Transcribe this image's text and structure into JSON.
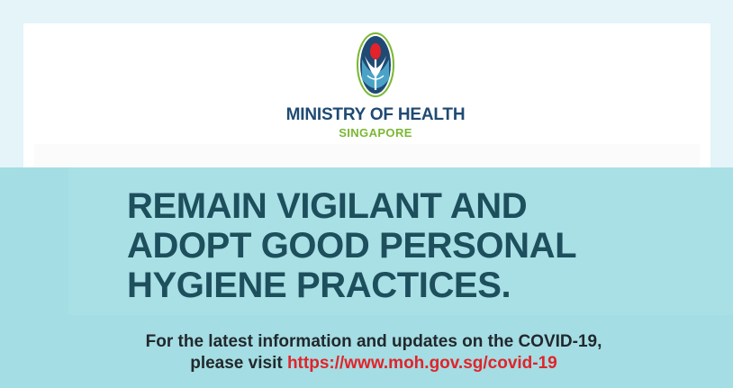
{
  "header": {
    "logo_icon": "moh-singapore-logo-icon",
    "ministry_name": "MINISTRY OF HEALTH",
    "country": "SINGAPORE"
  },
  "banner": {
    "headline_lines": [
      "REMAIN VIGILANT AND",
      "ADOPT GOOD PERSONAL",
      "HYGIENE PRACTICES."
    ],
    "info_line1": "For the latest information and updates on the COVID-19,",
    "info_line2_prefix": "please visit ",
    "info_link": "https://www.moh.gov.sg/covid-19"
  },
  "colors": {
    "background": "#e4f4f8",
    "banner": "#a4dde3",
    "headline": "#1e4f5c",
    "ministry_blue": "#1f4a73",
    "ministry_green": "#7ab833",
    "link_red": "#e2232a"
  }
}
